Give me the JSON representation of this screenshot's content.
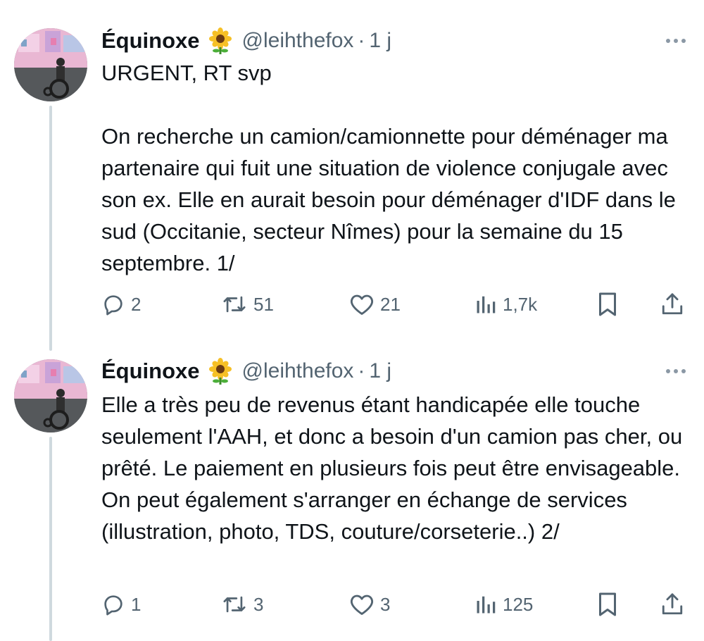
{
  "tweets": [
    {
      "author_name": "Équinoxe",
      "handle": "@leihthefox",
      "separator": "·",
      "time": "1 j",
      "paragraphs": [
        "URGENT, RT svp",
        "On recherche un camion/camionnette pour déménager ma partenaire qui fuit une situation de violence conjugale avec son ex. Elle en aurait besoin pour déménager d'IDF dans le sud (Occitanie, secteur Nîmes) pour la semaine du 15 septembre. 1/"
      ],
      "replies": "2",
      "retweets": "51",
      "likes": "21",
      "views": "1,7k"
    },
    {
      "author_name": "Équinoxe",
      "handle": "@leihthefox",
      "separator": "·",
      "time": "1 j",
      "paragraphs": [
        "Elle a très peu de revenus étant handicapée elle touche seulement l'AAH, et donc a besoin d'un camion pas cher, ou prêté. Le paiement en plusieurs fois peut être envisageable. On peut également s'arranger en échange de services (illustration, photo, TDS, couture/corseterie..) 2/"
      ],
      "replies": "1",
      "retweets": "3",
      "likes": "3",
      "views": "125"
    }
  ],
  "icons": {
    "emoji": "sunflower-icon",
    "more": "more-icon",
    "reply": "reply-icon",
    "retweet": "retweet-icon",
    "like": "heart-icon",
    "views": "views-icon",
    "bookmark": "bookmark-icon",
    "share": "share-icon"
  },
  "colors": {
    "text": "#0f1419",
    "secondary": "#536471",
    "thread_line": "#cfd9de"
  }
}
